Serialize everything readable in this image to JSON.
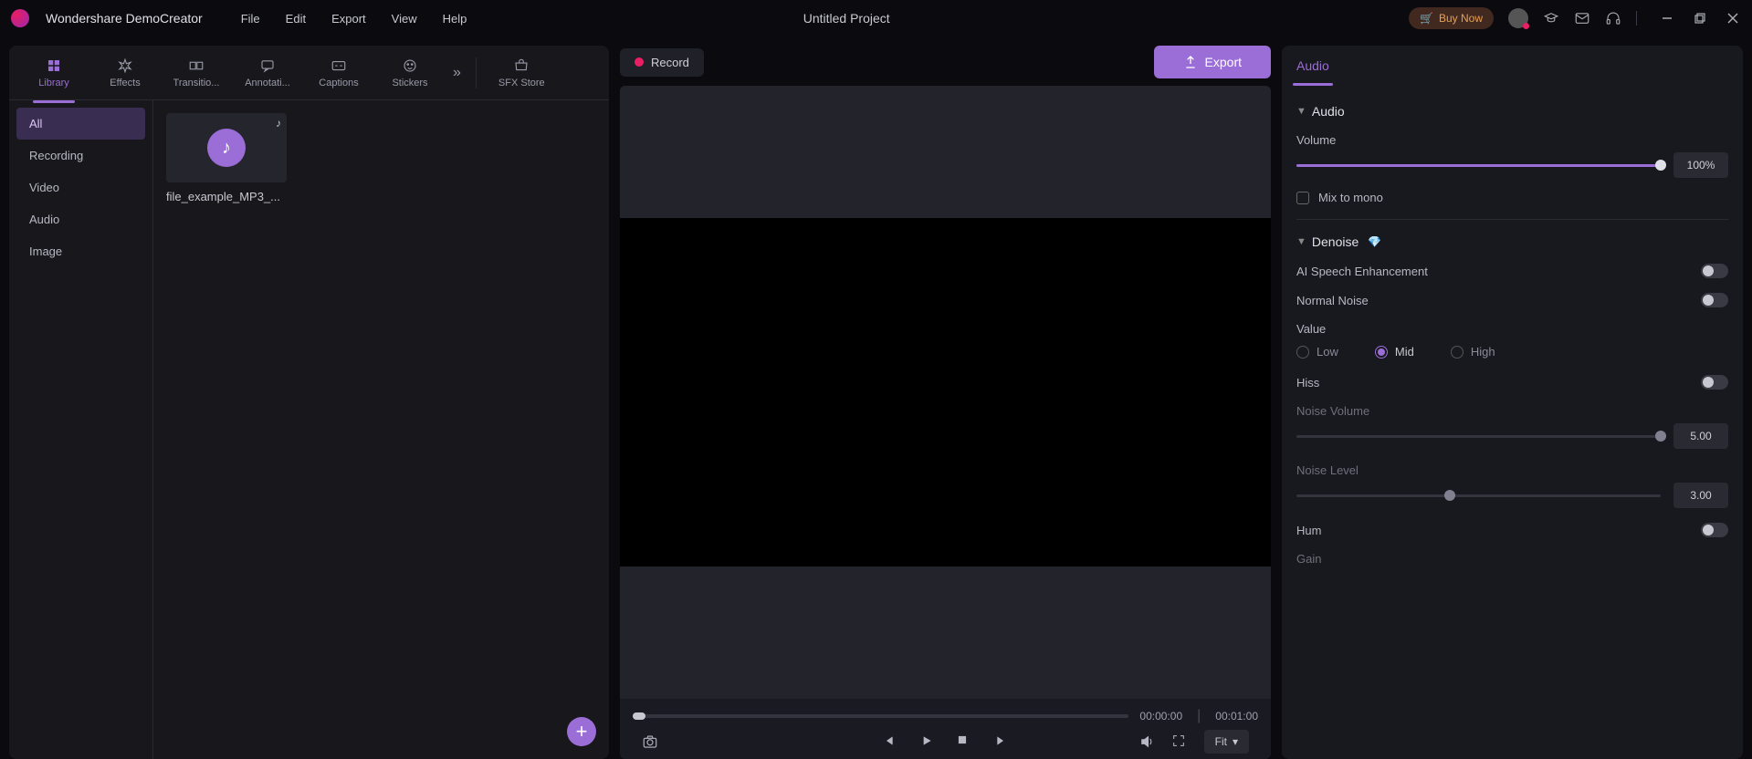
{
  "app_name": "Wondershare DemoCreator",
  "menu": [
    "File",
    "Edit",
    "Export",
    "View",
    "Help"
  ],
  "project_title": "Untitled Project",
  "buy_now": "Buy Now",
  "export_btn": "Export",
  "record_btn": "Record",
  "top_tabs": [
    "Library",
    "Effects",
    "Transitio...",
    "Annotati...",
    "Captions",
    "Stickers"
  ],
  "sfx_store": "SFX Store",
  "sidebar": [
    "All",
    "Recording",
    "Video",
    "Audio",
    "Image"
  ],
  "media": {
    "name": "file_example_MP3_..."
  },
  "preview": {
    "current": "00:00:00",
    "total": "00:01:00",
    "fit": "Fit"
  },
  "props": {
    "tab": "Audio",
    "section_audio": "Audio",
    "volume_label": "Volume",
    "volume_value": "100%",
    "mix_label": "Mix to mono",
    "section_denoise": "Denoise",
    "ai_speech": "AI Speech Enhancement",
    "normal_noise": "Normal Noise",
    "value_label": "Value",
    "radio_low": "Low",
    "radio_mid": "Mid",
    "radio_high": "High",
    "hiss": "Hiss",
    "noise_volume": "Noise Volume",
    "noise_volume_val": "5.00",
    "noise_level": "Noise Level",
    "noise_level_val": "3.00",
    "hum": "Hum",
    "gain": "Gain"
  }
}
